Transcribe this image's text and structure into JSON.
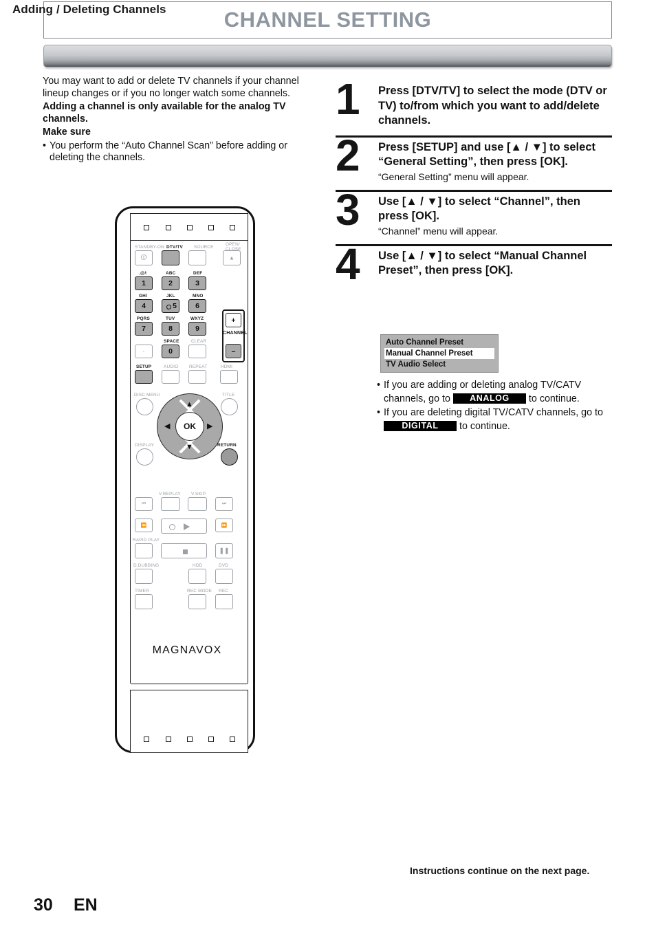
{
  "page": {
    "title": "CHANNEL SETTING",
    "section_title": "Adding / Deleting Channels",
    "page_number": "30",
    "language": "EN",
    "continue_note": "Instructions continue on the next page."
  },
  "intro": {
    "paragraph": "You may want to add or delete TV channels if your channel lineup changes or if you no longer watch some channels.",
    "bold_note": "Adding a channel is only available for the analog TV channels.",
    "make_sure_heading": "Make sure",
    "make_sure_bullet": "You perform the “Auto Channel Scan” before adding or deleting the channels.",
    "bullet_char": "•"
  },
  "steps": [
    {
      "number": "1",
      "heading": "Press [DTV/TV] to select the mode (DTV or TV) to/from which you want to add/delete channels.",
      "note": ""
    },
    {
      "number": "2",
      "heading": "Press [SETUP] and use [▲ / ▼] to select “General Setting”, then press [OK].",
      "note": "“General Setting” menu will appear."
    },
    {
      "number": "3",
      "heading": "Use [▲ / ▼] to select “Channel”, then press [OK].",
      "note": "“Channel” menu will appear."
    },
    {
      "number": "4",
      "heading": "Use [▲ / ▼] to select “Manual Channel Preset”, then press [OK].",
      "note": ""
    }
  ],
  "osd_menu": {
    "rows": [
      {
        "label": "Auto Channel Preset",
        "selected": false
      },
      {
        "label": "Manual Channel Preset",
        "selected": true
      },
      {
        "label": "TV Audio Select",
        "selected": false
      }
    ]
  },
  "mode_bullets": [
    {
      "pre": "If you are adding or deleting analog TV/CATV channels, go to ",
      "tag": "ANALOG",
      "post": " to continue."
    },
    {
      "pre": "If you are deleting digital TV/CATV channels, go to ",
      "tag": "DIGITAL",
      "post": " to continue."
    }
  ],
  "remote": {
    "brand": "MAGNAVOX",
    "labels": {
      "standby_on": "STANDBY-ON",
      "dtv_tv": "DTV/TV",
      "source": "SOURCE",
      "open_close_1": "OPEN/",
      "open_close_2": "CLOSE",
      "key1_sub": ".@/:",
      "key2_sub": "ABC",
      "key3_sub": "DEF",
      "key4_sub": "GHI",
      "key5_sub": "JKL",
      "key6_sub": "MNO",
      "key7_sub": "PQRS",
      "key8_sub": "TUV",
      "key9_sub": "WXYZ",
      "key0_sub": "SPACE",
      "clear": "CLEAR",
      "channel": "CHANNEL",
      "channel_plus": "+",
      "channel_minus": "–",
      "setup": "SETUP",
      "audio": "AUDIO",
      "repeat": "REPEAT",
      "hdmi": "HDMI",
      "disc_menu": "DISC MENU",
      "title": "TITLE",
      "display": "DISPLAY",
      "return": "RETURN",
      "ok": "OK",
      "v_replay": "V.REPLAY",
      "v_skip": "V.SKIP",
      "rapid_play": "RAPID PLAY",
      "d_dubbing": "D.DUBBING",
      "hdd": "HDD",
      "dvd": "DVD",
      "timer": "TIMER",
      "rec_mode": "REC MODE",
      "rec": "REC"
    },
    "keys": {
      "k1": "1",
      "k2": "2",
      "k3": "3",
      "k4": "4",
      "k5": "5",
      "k6": "6",
      "k7": "7",
      "k8": "8",
      "k9": "9",
      "kdot": "·",
      "k0": "0"
    }
  },
  "colors": {
    "title_gray": "#8e979f",
    "bar_light": "#dcdee0",
    "bar_dark": "#4c5055",
    "osd_bg": "#b2b2b2",
    "tag_bg": "#000000"
  }
}
